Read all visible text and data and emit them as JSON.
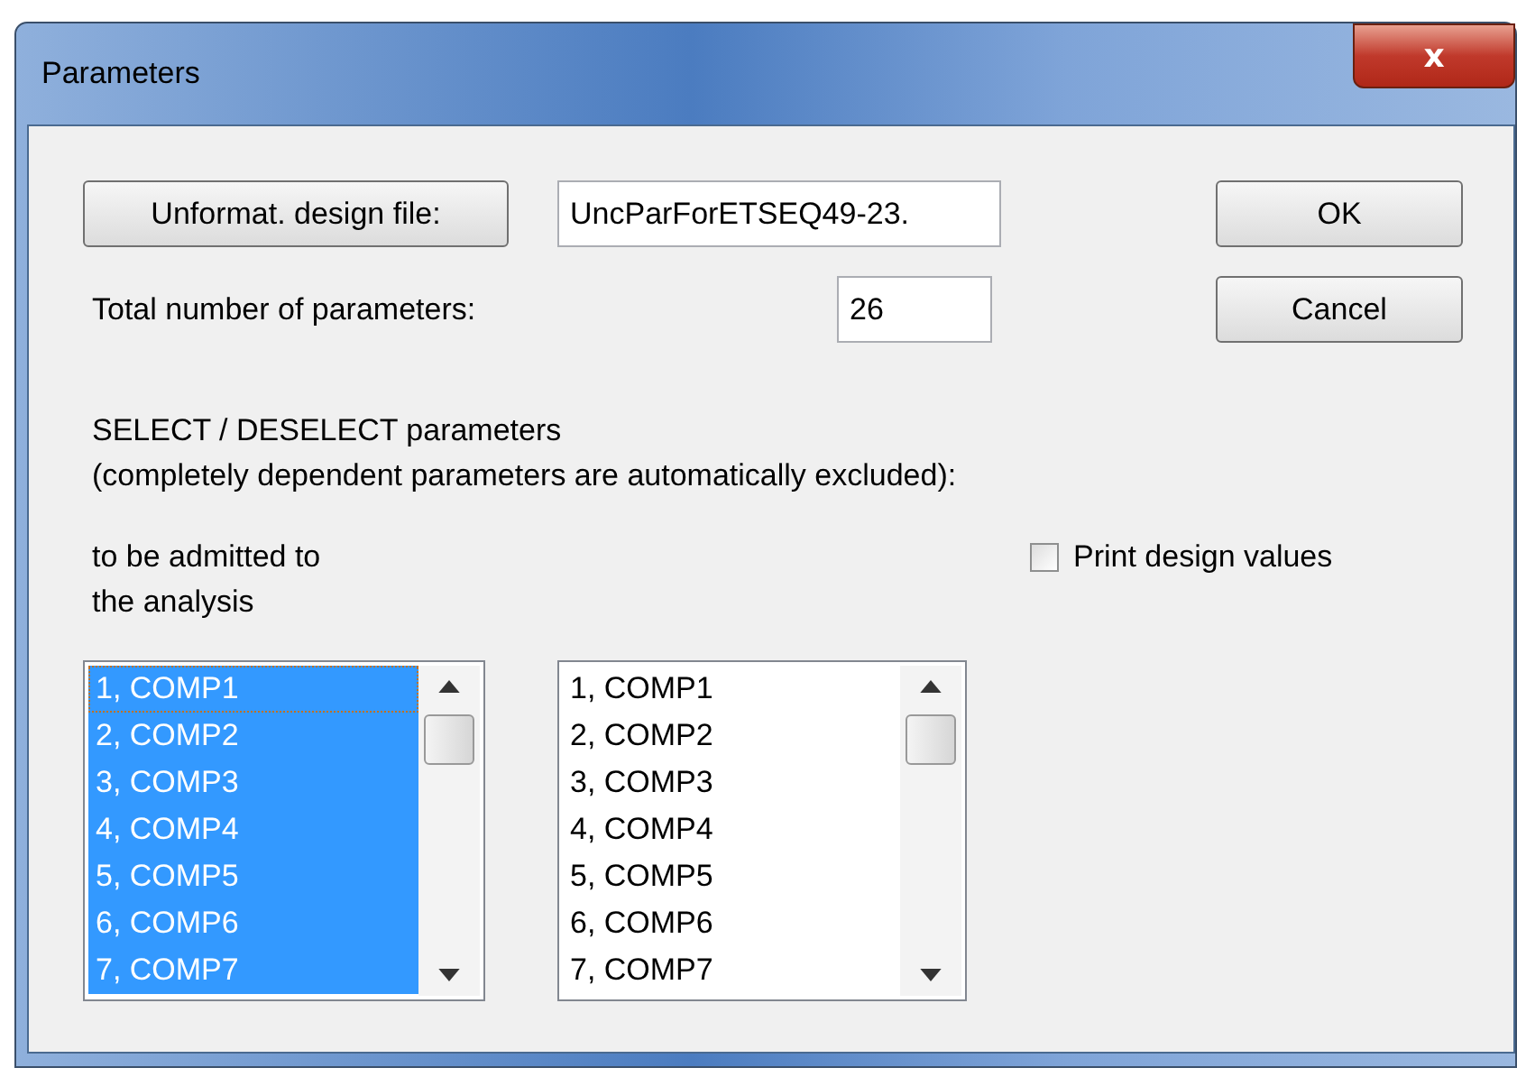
{
  "window": {
    "title": "Parameters",
    "close": "x"
  },
  "file_button": "Unformat. design file:",
  "file_field": {
    "value": "UncParForETSEQ49-23."
  },
  "total": {
    "label": "Total number of parameters:",
    "value": "26"
  },
  "buttons": [
    "OK",
    "Cancel"
  ],
  "instructions": [
    "SELECT / DESELECT parameters",
    "(completely dependent parameters are automatically excluded):"
  ],
  "list_label": [
    "to be admitted to",
    "the analysis"
  ],
  "print_design_values": {
    "label": "Print design values",
    "checked": false
  },
  "lists": [
    {
      "items": [
        {
          "label": "1, COMP1",
          "selected": true
        },
        {
          "label": "2, COMP2",
          "selected": true
        },
        {
          "label": "3, COMP3",
          "selected": true
        },
        {
          "label": "4, COMP4",
          "selected": true
        },
        {
          "label": "5, COMP5",
          "selected": true
        },
        {
          "label": "6, COMP6",
          "selected": true
        },
        {
          "label": "7, COMP7",
          "selected": true
        }
      ]
    },
    {
      "items": [
        {
          "label": "1, COMP1",
          "selected": false
        },
        {
          "label": "2, COMP2",
          "selected": false
        },
        {
          "label": "3, COMP3",
          "selected": false
        },
        {
          "label": "4, COMP4",
          "selected": false
        },
        {
          "label": "5, COMP5",
          "selected": false
        },
        {
          "label": "6, COMP6",
          "selected": false
        },
        {
          "label": "7, COMP7",
          "selected": false
        }
      ]
    }
  ]
}
